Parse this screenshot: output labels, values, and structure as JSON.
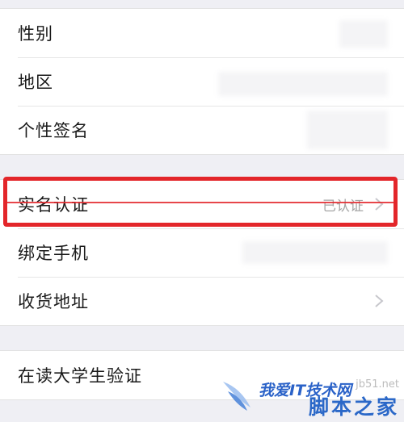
{
  "profile_group": {
    "items": [
      {
        "label": "性别"
      },
      {
        "label": "地区"
      },
      {
        "label": "个性签名"
      }
    ]
  },
  "verify_group": {
    "items": [
      {
        "label": "实名认证",
        "value": "已认证"
      },
      {
        "label": "绑定手机"
      },
      {
        "label": "收货地址"
      }
    ]
  },
  "student_group": {
    "items": [
      {
        "label": "在读大学生验证"
      }
    ]
  },
  "watermark": {
    "text": "我爱IT技术网",
    "url": "jb51.net",
    "brand": "脚本之家"
  },
  "colors": {
    "highlight": "#e3262a",
    "watermark_blue": "#2b68c8"
  }
}
